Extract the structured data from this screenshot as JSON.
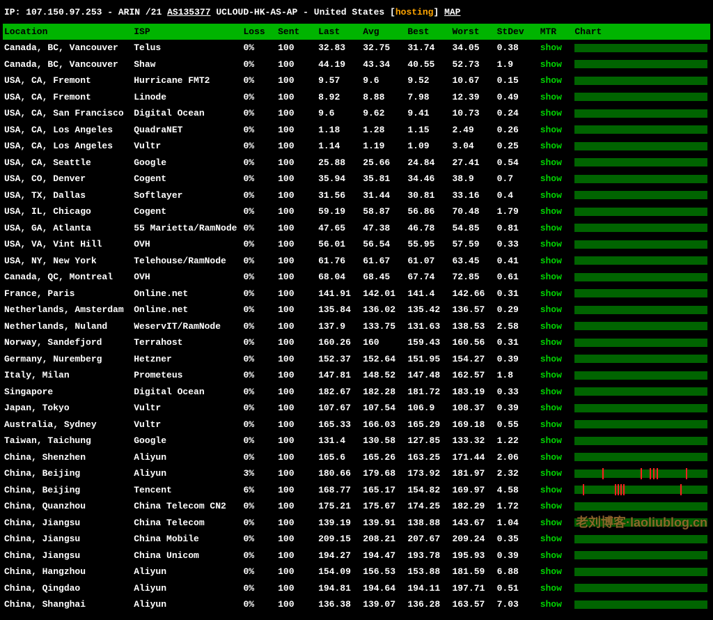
{
  "ipline": {
    "ip_label": "IP:",
    "ip": "107.150.97.253",
    "registry": "ARIN",
    "prefix": "/21",
    "asn": "AS135377",
    "asname": "UCLOUD-HK-AS-AP",
    "country_sep": "-",
    "country": "United States",
    "tag": "hosting",
    "map": "MAP"
  },
  "columns": {
    "loc": "Location",
    "isp": "ISP",
    "loss": "Loss",
    "sent": "Sent",
    "last": "Last",
    "avg": "Avg",
    "best": "Best",
    "worst": "Worst",
    "stdev": "StDev",
    "mtr": "MTR",
    "chart": "Chart"
  },
  "mtr_label": "show",
  "watermark": "老刘博客·laoliublog.cn",
  "rows": [
    {
      "loc": "Canada, BC, Vancouver",
      "isp": "Telus",
      "loss": "0%",
      "sent": "100",
      "last": "32.83",
      "avg": "32.75",
      "best": "31.74",
      "worst": "34.05",
      "stdev": "0.38",
      "spikes": []
    },
    {
      "loc": "Canada, BC, Vancouver",
      "isp": "Shaw",
      "loss": "0%",
      "sent": "100",
      "last": "44.19",
      "avg": "43.34",
      "best": "40.55",
      "worst": "52.73",
      "stdev": "1.9",
      "spikes": []
    },
    {
      "loc": "USA, CA, Fremont",
      "isp": "Hurricane FMT2",
      "loss": "0%",
      "sent": "100",
      "last": "9.57",
      "avg": "9.6",
      "best": "9.52",
      "worst": "10.67",
      "stdev": "0.15",
      "spikes": []
    },
    {
      "loc": "USA, CA, Fremont",
      "isp": "Linode",
      "loss": "0%",
      "sent": "100",
      "last": "8.92",
      "avg": "8.88",
      "best": "7.98",
      "worst": "12.39",
      "stdev": "0.49",
      "spikes": []
    },
    {
      "loc": "USA, CA, San Francisco",
      "isp": "Digital Ocean",
      "loss": "0%",
      "sent": "100",
      "last": "9.6",
      "avg": "9.62",
      "best": "9.41",
      "worst": "10.73",
      "stdev": "0.24",
      "spikes": []
    },
    {
      "loc": "USA, CA, Los Angeles",
      "isp": "QuadraNET",
      "loss": "0%",
      "sent": "100",
      "last": "1.18",
      "avg": "1.28",
      "best": "1.15",
      "worst": "2.49",
      "stdev": "0.26",
      "spikes": []
    },
    {
      "loc": "USA, CA, Los Angeles",
      "isp": "Vultr",
      "loss": "0%",
      "sent": "100",
      "last": "1.14",
      "avg": "1.19",
      "best": "1.09",
      "worst": "3.04",
      "stdev": "0.25",
      "spikes": []
    },
    {
      "loc": "USA, CA, Seattle",
      "isp": "Google",
      "loss": "0%",
      "sent": "100",
      "last": "25.88",
      "avg": "25.66",
      "best": "24.84",
      "worst": "27.41",
      "stdev": "0.54",
      "spikes": []
    },
    {
      "loc": "USA, CO, Denver",
      "isp": "Cogent",
      "loss": "0%",
      "sent": "100",
      "last": "35.94",
      "avg": "35.81",
      "best": "34.46",
      "worst": "38.9",
      "stdev": "0.7",
      "spikes": []
    },
    {
      "loc": "USA, TX, Dallas",
      "isp": "Softlayer",
      "loss": "0%",
      "sent": "100",
      "last": "31.56",
      "avg": "31.44",
      "best": "30.81",
      "worst": "33.16",
      "stdev": "0.4",
      "spikes": []
    },
    {
      "loc": "USA, IL, Chicago",
      "isp": "Cogent",
      "loss": "0%",
      "sent": "100",
      "last": "59.19",
      "avg": "58.87",
      "best": "56.86",
      "worst": "70.48",
      "stdev": "1.79",
      "spikes": []
    },
    {
      "loc": "USA, GA, Atlanta",
      "isp": "55 Marietta/RamNode",
      "loss": "0%",
      "sent": "100",
      "last": "47.65",
      "avg": "47.38",
      "best": "46.78",
      "worst": "54.85",
      "stdev": "0.81",
      "spikes": []
    },
    {
      "loc": "USA, VA, Vint Hill",
      "isp": "OVH",
      "loss": "0%",
      "sent": "100",
      "last": "56.01",
      "avg": "56.54",
      "best": "55.95",
      "worst": "57.59",
      "stdev": "0.33",
      "spikes": []
    },
    {
      "loc": "USA, NY, New York",
      "isp": "Telehouse/RamNode",
      "loss": "0%",
      "sent": "100",
      "last": "61.76",
      "avg": "61.67",
      "best": "61.07",
      "worst": "63.45",
      "stdev": "0.41",
      "spikes": []
    },
    {
      "loc": "Canada, QC, Montreal",
      "isp": "OVH",
      "loss": "0%",
      "sent": "100",
      "last": "68.04",
      "avg": "68.45",
      "best": "67.74",
      "worst": "72.85",
      "stdev": "0.61",
      "spikes": []
    },
    {
      "loc": "France, Paris",
      "isp": "Online.net",
      "loss": "0%",
      "sent": "100",
      "last": "141.91",
      "avg": "142.01",
      "best": "141.4",
      "worst": "142.66",
      "stdev": "0.31",
      "spikes": []
    },
    {
      "loc": "Netherlands, Amsterdam",
      "isp": "Online.net",
      "loss": "0%",
      "sent": "100",
      "last": "135.84",
      "avg": "136.02",
      "best": "135.42",
      "worst": "136.57",
      "stdev": "0.29",
      "spikes": []
    },
    {
      "loc": "Netherlands, Nuland",
      "isp": "WeservIT/RamNode",
      "loss": "0%",
      "sent": "100",
      "last": "137.9",
      "avg": "133.75",
      "best": "131.63",
      "worst": "138.53",
      "stdev": "2.58",
      "spikes": []
    },
    {
      "loc": "Norway, Sandefjord",
      "isp": "Terrahost",
      "loss": "0%",
      "sent": "100",
      "last": "160.26",
      "avg": "160",
      "best": "159.43",
      "worst": "160.56",
      "stdev": "0.31",
      "spikes": []
    },
    {
      "loc": "Germany, Nuremberg",
      "isp": "Hetzner",
      "loss": "0%",
      "sent": "100",
      "last": "152.37",
      "avg": "152.64",
      "best": "151.95",
      "worst": "154.27",
      "stdev": "0.39",
      "spikes": []
    },
    {
      "loc": "Italy, Milan",
      "isp": "Prometeus",
      "loss": "0%",
      "sent": "100",
      "last": "147.81",
      "avg": "148.52",
      "best": "147.48",
      "worst": "162.57",
      "stdev": "1.8",
      "spikes": []
    },
    {
      "loc": "Singapore",
      "isp": "Digital Ocean",
      "loss": "0%",
      "sent": "100",
      "last": "182.67",
      "avg": "182.28",
      "best": "181.72",
      "worst": "183.19",
      "stdev": "0.33",
      "spikes": []
    },
    {
      "loc": "Japan, Tokyo",
      "isp": "Vultr",
      "loss": "0%",
      "sent": "100",
      "last": "107.67",
      "avg": "107.54",
      "best": "106.9",
      "worst": "108.37",
      "stdev": "0.39",
      "spikes": []
    },
    {
      "loc": "Australia, Sydney",
      "isp": "Vultr",
      "loss": "0%",
      "sent": "100",
      "last": "165.33",
      "avg": "166.03",
      "best": "165.29",
      "worst": "169.18",
      "stdev": "0.55",
      "spikes": []
    },
    {
      "loc": "Taiwan, Taichung",
      "isp": "Google",
      "loss": "0%",
      "sent": "100",
      "last": "131.4",
      "avg": "130.58",
      "best": "127.85",
      "worst": "133.32",
      "stdev": "1.22",
      "spikes": []
    },
    {
      "loc": "China, Shenzhen",
      "isp": "Aliyun",
      "loss": "0%",
      "sent": "100",
      "last": "165.6",
      "avg": "165.26",
      "best": "163.25",
      "worst": "171.44",
      "stdev": "2.06",
      "spikes": []
    },
    {
      "loc": "China, Beijing",
      "isp": "Aliyun",
      "loss": "3%",
      "sent": "100",
      "last": "180.66",
      "avg": "179.68",
      "best": "173.92",
      "worst": "181.97",
      "stdev": "2.32",
      "spikes": [
        40,
        95,
        108,
        113,
        118,
        160
      ]
    },
    {
      "loc": "China, Beijing",
      "isp": "Tencent",
      "loss": "6%",
      "sent": "100",
      "last": "168.77",
      "avg": "165.17",
      "best": "154.82",
      "worst": "169.97",
      "stdev": "4.58",
      "spikes": [
        12,
        58,
        62,
        66,
        70,
        152
      ]
    },
    {
      "loc": "China, Quanzhou",
      "isp": "China Telecom CN2",
      "loss": "0%",
      "sent": "100",
      "last": "175.21",
      "avg": "175.67",
      "best": "174.25",
      "worst": "182.29",
      "stdev": "1.72",
      "spikes": []
    },
    {
      "loc": "China, Jiangsu",
      "isp": "China Telecom",
      "loss": "0%",
      "sent": "100",
      "last": "139.19",
      "avg": "139.91",
      "best": "138.88",
      "worst": "143.67",
      "stdev": "1.04",
      "spikes": []
    },
    {
      "loc": "China, Jiangsu",
      "isp": "China Mobile",
      "loss": "0%",
      "sent": "100",
      "last": "209.15",
      "avg": "208.21",
      "best": "207.67",
      "worst": "209.24",
      "stdev": "0.35",
      "spikes": []
    },
    {
      "loc": "China, Jiangsu",
      "isp": "China Unicom",
      "loss": "0%",
      "sent": "100",
      "last": "194.27",
      "avg": "194.47",
      "best": "193.78",
      "worst": "195.93",
      "stdev": "0.39",
      "spikes": []
    },
    {
      "loc": "China, Hangzhou",
      "isp": "Aliyun",
      "loss": "0%",
      "sent": "100",
      "last": "154.09",
      "avg": "156.53",
      "best": "153.88",
      "worst": "181.59",
      "stdev": "6.88",
      "spikes": []
    },
    {
      "loc": "China, Qingdao",
      "isp": "Aliyun",
      "loss": "0%",
      "sent": "100",
      "last": "194.81",
      "avg": "194.64",
      "best": "194.11",
      "worst": "197.71",
      "stdev": "0.51",
      "spikes": []
    },
    {
      "loc": "China, Shanghai",
      "isp": "Aliyun",
      "loss": "0%",
      "sent": "100",
      "last": "136.38",
      "avg": "139.07",
      "best": "136.28",
      "worst": "163.57",
      "stdev": "7.03",
      "spikes": []
    }
  ]
}
